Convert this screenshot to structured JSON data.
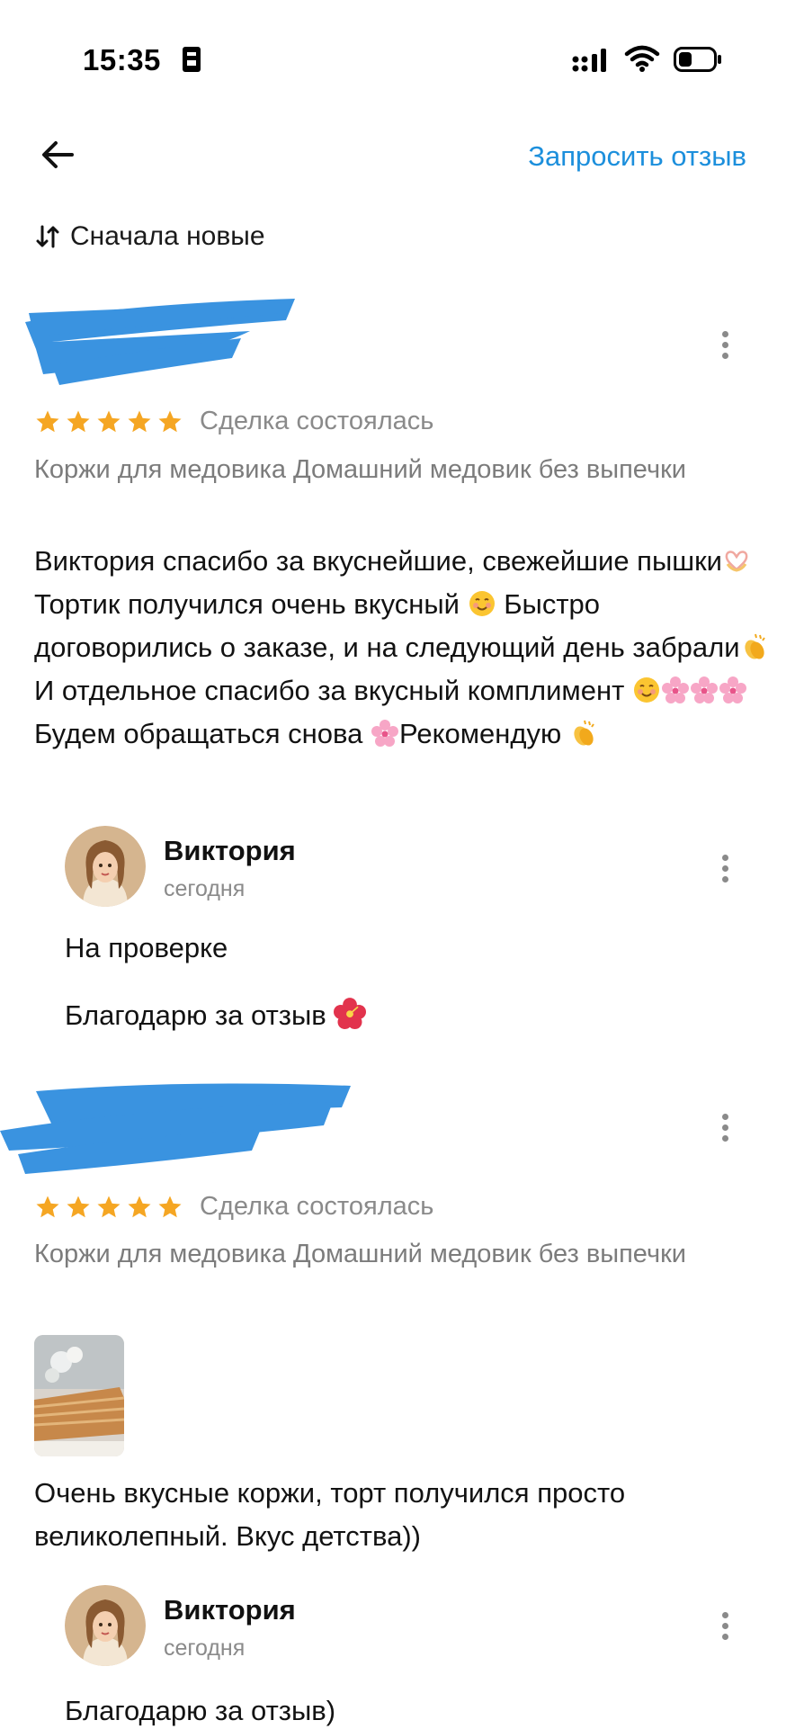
{
  "status_bar": {
    "time": "15:35"
  },
  "header": {
    "request_review_label": "Запросить отзыв",
    "back_icon": "arrow-left-icon"
  },
  "sort": {
    "label": "Сначала новые",
    "icon": "sort-icon"
  },
  "colors": {
    "accent": "#1c8fdc",
    "star": "#f5a623",
    "muted": "#8a8a8a",
    "redaction": "#3a93e0"
  },
  "reviews": [
    {
      "rating": 5,
      "deal_status": "Сделка состоялась",
      "product": "Коржи для медовика Домашний медовик без выпечки",
      "text_parts": [
        "Виктория спасибо за вкуснейшие, свежейшие пышки",
        "Тортик получился очень вкусный ",
        " Быстро договорились о заказе, и на следующий день забрали",
        "И отдельное спасибо за вкусный комплимент ",
        "Будем обращаться снова ",
        "Рекомендую "
      ],
      "reply": {
        "seller_name": "Виктория",
        "date": "сегодня",
        "status": "На проверке",
        "text": "Благодарю за отзыв "
      }
    },
    {
      "rating": 5,
      "deal_status": "Сделка состоялась",
      "product": "Коржи для медовика Домашний медовик без выпечки",
      "text": "Очень вкусные коржи, торт получился просто великолепный. Вкус детства))",
      "reply": {
        "seller_name": "Виктория",
        "date": "сегодня",
        "text": "Благодарю за отзыв)"
      }
    }
  ]
}
